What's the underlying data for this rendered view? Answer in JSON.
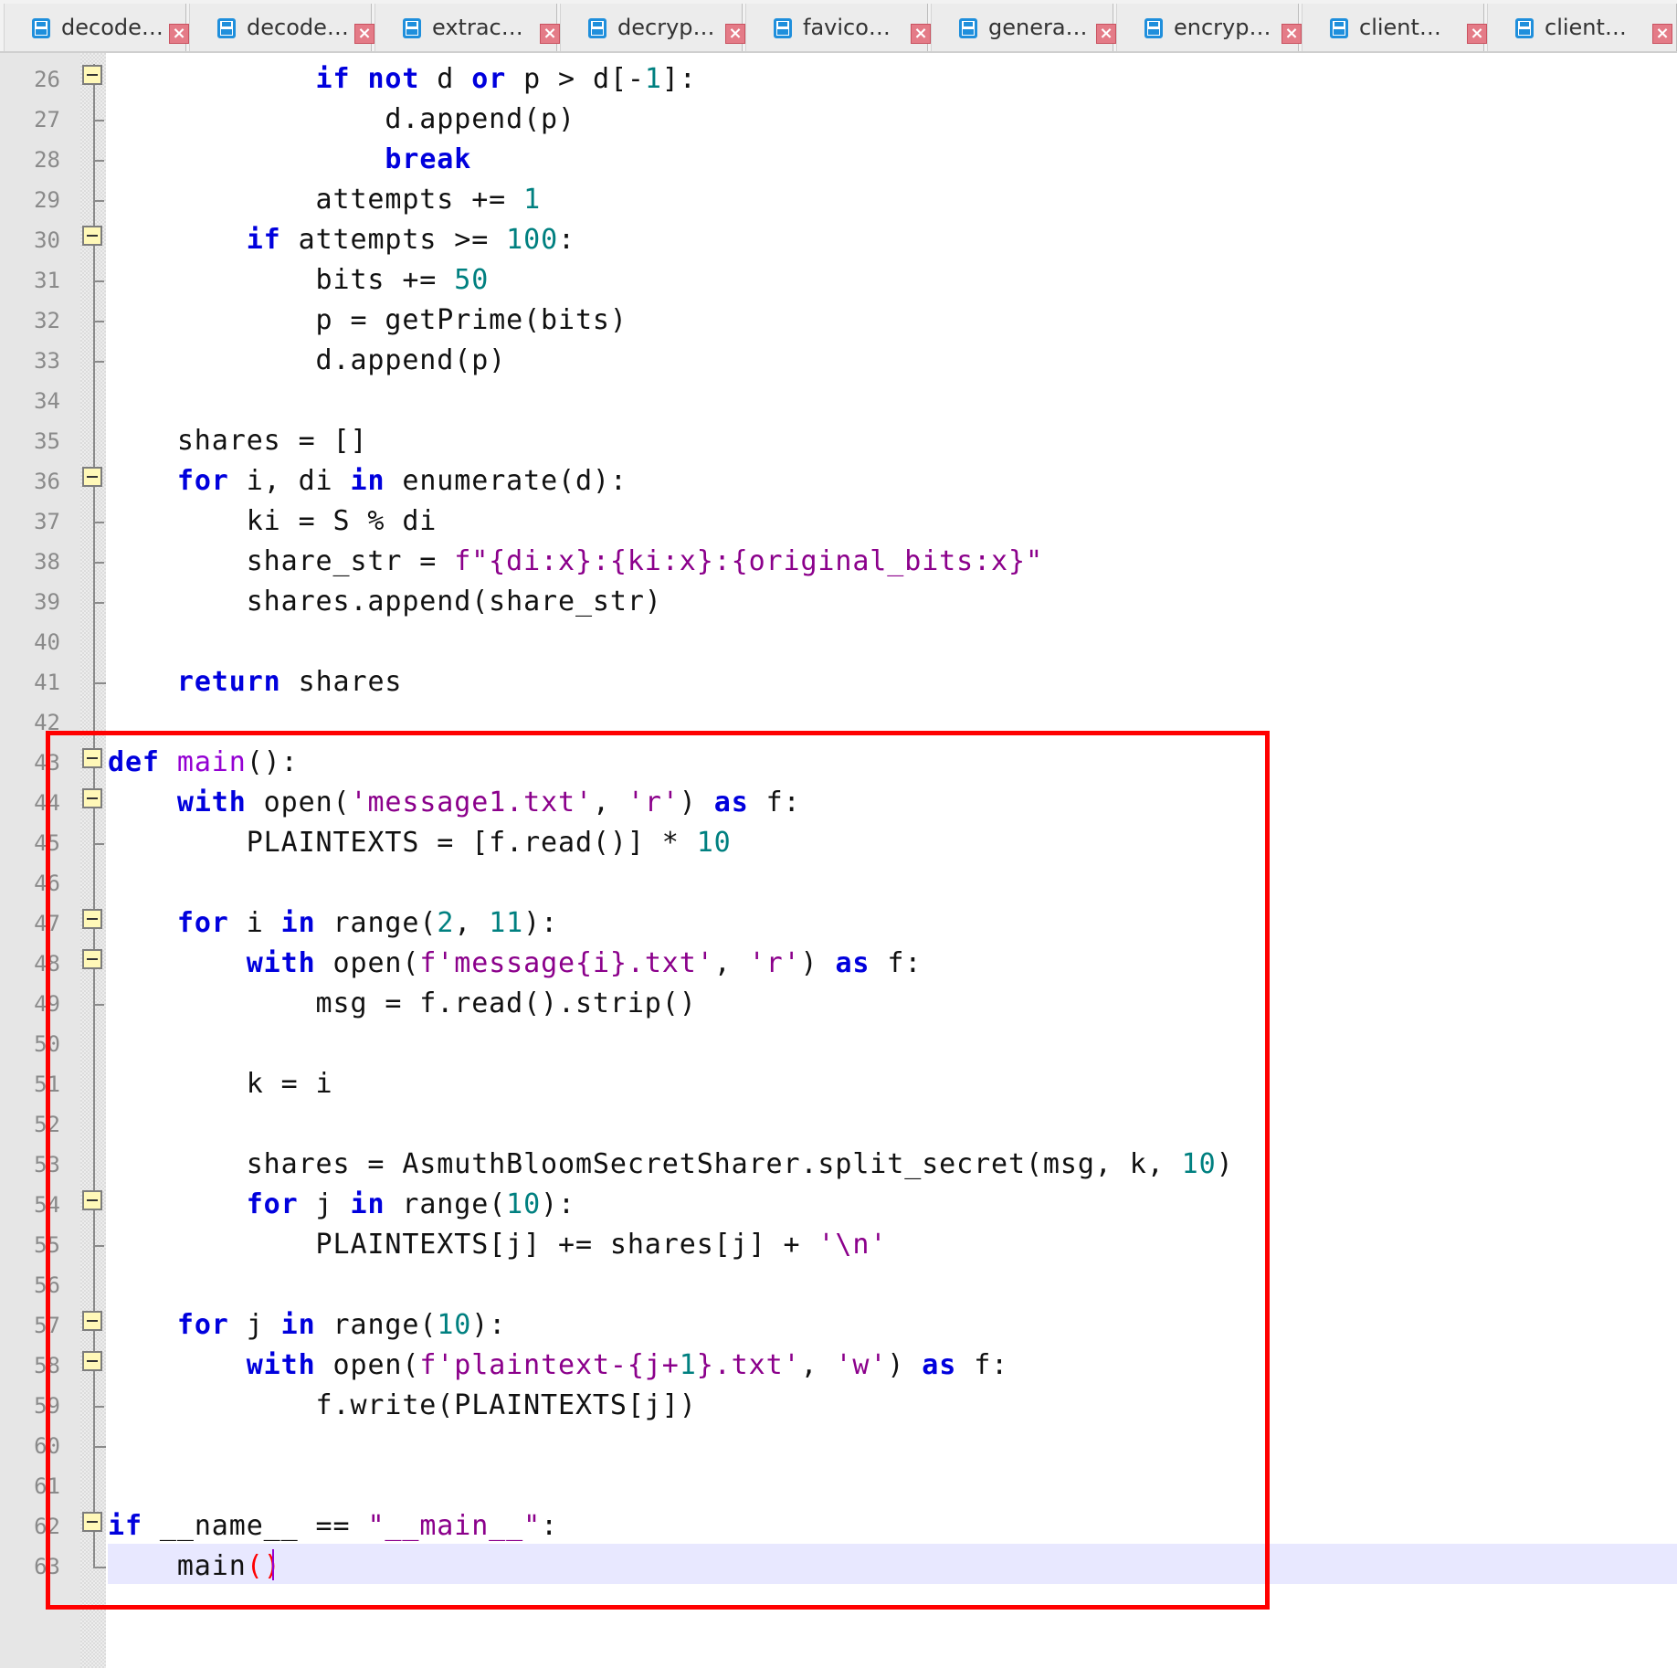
{
  "tabs": [
    {
      "label": "decode…",
      "icon": "save-icon"
    },
    {
      "label": "decode…",
      "icon": "save-icon"
    },
    {
      "label": "extrac…",
      "icon": "save-icon"
    },
    {
      "label": "decryp…",
      "icon": "save-icon"
    },
    {
      "label": "favico…",
      "icon": "save-icon"
    },
    {
      "label": "genera…",
      "icon": "save-icon"
    },
    {
      "label": "encryp…",
      "icon": "save-icon"
    },
    {
      "label": "client…",
      "icon": "save-icon"
    },
    {
      "label": "client…",
      "icon": "save-icon"
    }
  ],
  "tab_close_glyph": "×",
  "line_numbers": [
    "26",
    "27",
    "28",
    "29",
    "30",
    "31",
    "32",
    "33",
    "34",
    "35",
    "36",
    "37",
    "38",
    "39",
    "40",
    "41",
    "42",
    "43",
    "44",
    "45",
    "46",
    "47",
    "48",
    "49",
    "50",
    "51",
    "52",
    "53",
    "54",
    "55",
    "56",
    "57",
    "58",
    "59",
    "60",
    "61",
    "62",
    "63"
  ],
  "code": {
    "l26": {
      "a": "            ",
      "b": "if",
      "c": " ",
      "d": "not",
      "e": " d ",
      "f": "or",
      "g": " p > d[-",
      "h": "1",
      "i": "]:"
    },
    "l27": {
      "a": "                d.append(p)"
    },
    "l28": {
      "a": "                ",
      "b": "break"
    },
    "l29": {
      "a": "            attempts += ",
      "b": "1"
    },
    "l30": {
      "a": "        ",
      "b": "if",
      "c": " attempts >= ",
      "d": "100",
      "e": ":"
    },
    "l31": {
      "a": "            bits += ",
      "b": "50"
    },
    "l32": {
      "a": "            p = getPrime(bits)"
    },
    "l33": {
      "a": "            d.append(p)"
    },
    "l34": {
      "a": ""
    },
    "l35": {
      "a": "    shares = []"
    },
    "l36": {
      "a": "    ",
      "b": "for",
      "c": " i, di ",
      "d": "in",
      "e": " enumerate(d):"
    },
    "l37": {
      "a": "        ki = S % di"
    },
    "l38": {
      "a": "        share_str = ",
      "b": "f\"{di:x}:{ki:x}:{original_bits:x}\""
    },
    "l39": {
      "a": "        shares.append(share_str)"
    },
    "l40": {
      "a": ""
    },
    "l41": {
      "a": "    ",
      "b": "return",
      "c": " shares"
    },
    "l42": {
      "a": ""
    },
    "l43": {
      "a": "",
      "b": "def",
      "c": " ",
      "d": "main",
      "e": "():"
    },
    "l44": {
      "a": "    ",
      "b": "with",
      "c": " open(",
      "d": "'message1.txt'",
      "e": ", ",
      "f": "'r'",
      "g": ") ",
      "h": "as",
      "i": " f:"
    },
    "l45": {
      "a": "        PLAINTEXTS = [f.read()] * ",
      "b": "10"
    },
    "l46": {
      "a": ""
    },
    "l47": {
      "a": "    ",
      "b": "for",
      "c": " i ",
      "d": "in",
      "e": " range(",
      "f": "2",
      "g": ", ",
      "h": "11",
      "i": "):"
    },
    "l48": {
      "a": "        ",
      "b": "with",
      "c": " open(",
      "d": "f'message{i}.txt'",
      "e": ", ",
      "f": "'r'",
      "g": ") ",
      "h": "as",
      "i": " f:"
    },
    "l49": {
      "a": "            msg = f.read().strip()"
    },
    "l50": {
      "a": ""
    },
    "l51": {
      "a": "        k = i"
    },
    "l52": {
      "a": ""
    },
    "l53": {
      "a": "        shares = AsmuthBloomSecretSharer.split_secret(msg, k, ",
      "b": "10",
      "c": ")"
    },
    "l54": {
      "a": "        ",
      "b": "for",
      "c": " j ",
      "d": "in",
      "e": " range(",
      "f": "10",
      "g": "):"
    },
    "l55": {
      "a": "            PLAINTEXTS[j] += shares[j] + ",
      "b": "'\\n'"
    },
    "l56": {
      "a": ""
    },
    "l57": {
      "a": "    ",
      "b": "for",
      "c": " j ",
      "d": "in",
      "e": " range(",
      "f": "10",
      "g": "):"
    },
    "l58": {
      "a": "        ",
      "b": "with",
      "c": " open(",
      "d": "f'plaintext-{j+",
      "e": "1",
      "f": "}.txt'",
      "g": ", ",
      "h": "'w'",
      "i": ") ",
      "j": "as",
      "k": " f:"
    },
    "l59": {
      "a": "            f.write(PLAINTEXTS[j])"
    },
    "l60": {
      "a": ""
    },
    "l61": {
      "a": ""
    },
    "l62": {
      "a": "",
      "b": "if",
      "c": " __name__ == ",
      "d": "\"__main__\"",
      "e": ":"
    },
    "l63": {
      "a": "    main",
      "b": "()"
    }
  },
  "colors": {
    "keyword": "#0000dd",
    "number": "#008080",
    "string": "#8b008b",
    "function_name": "#9400d3",
    "highlight_box": "#ff0000",
    "tab_icon": "#1f8fdc",
    "tab_close": "#e47b87"
  }
}
